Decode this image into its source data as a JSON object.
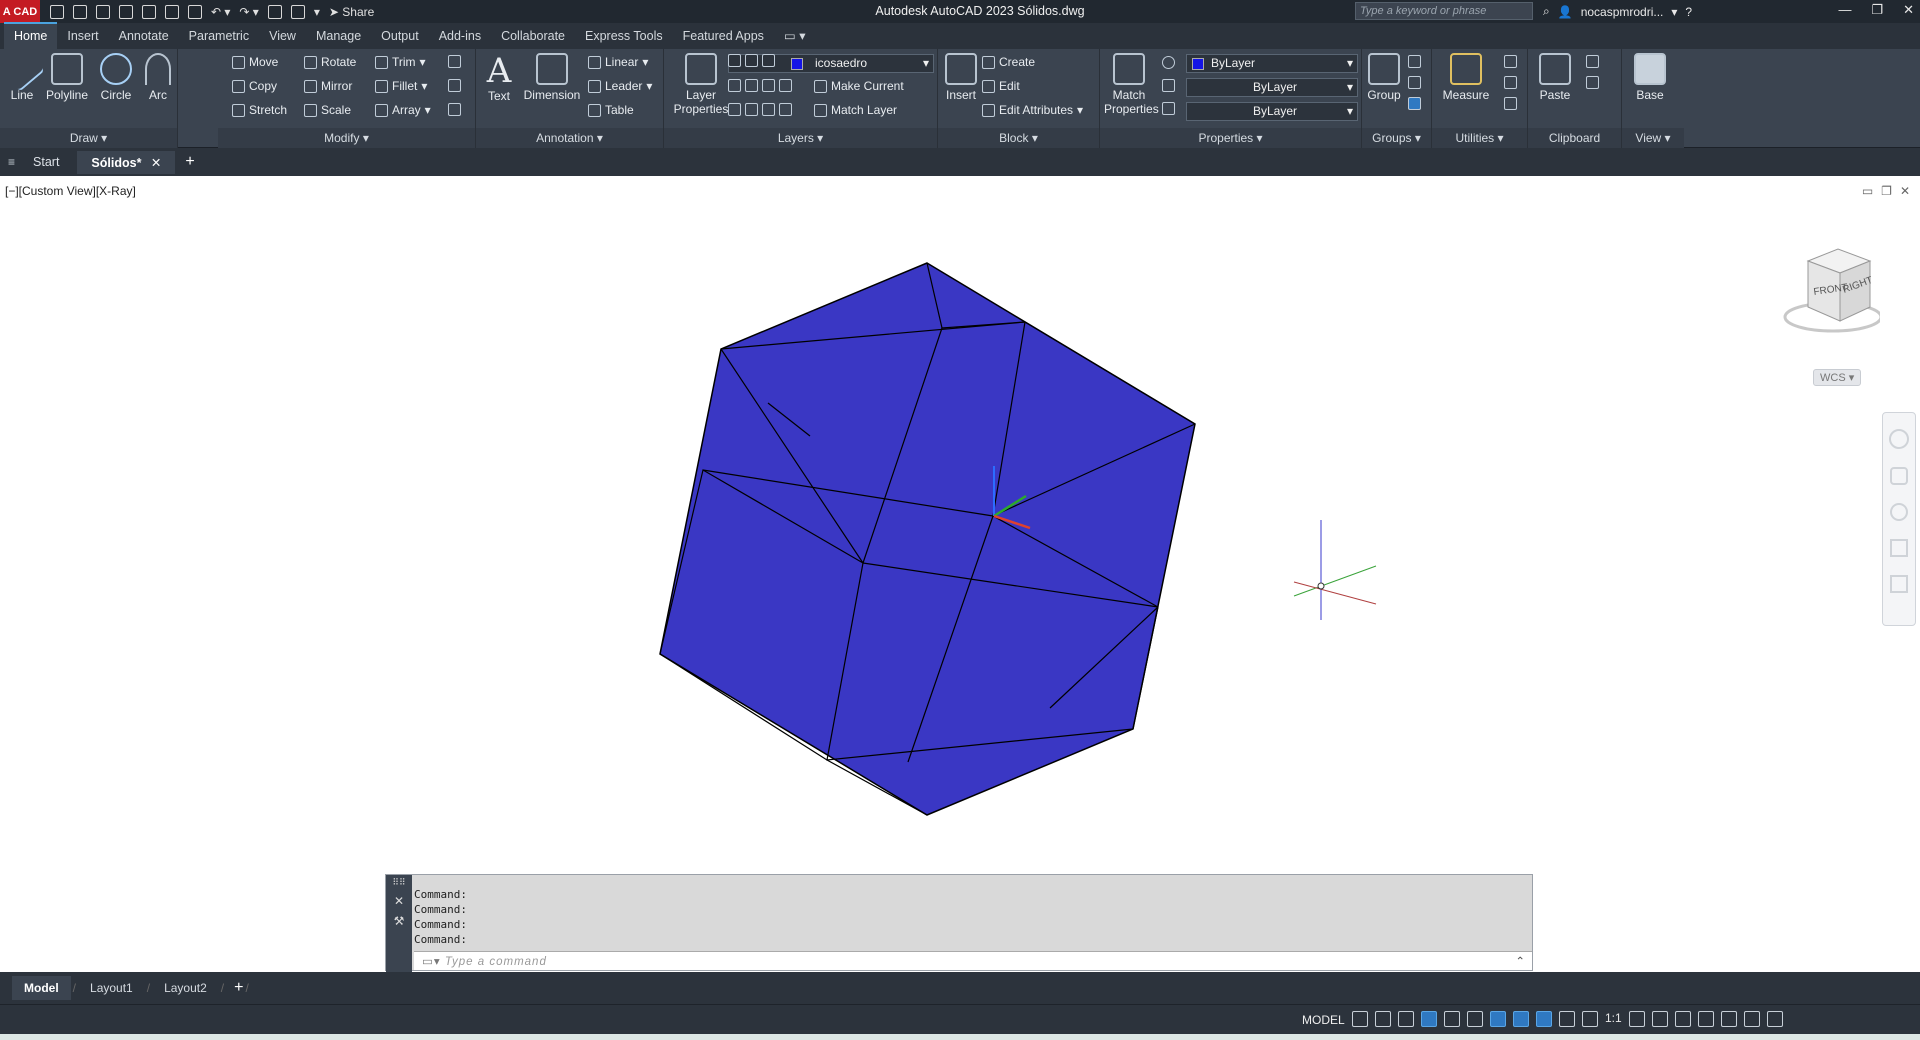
{
  "titlebar": {
    "app_logo": "A CAD",
    "share_label": "Share",
    "title": "Autodesk AutoCAD 2023   Sólidos.dwg",
    "search_placeholder": "Type a keyword or phrase",
    "user": "nocaspmrodri..."
  },
  "ribbon_tabs": [
    "Home",
    "Insert",
    "Annotate",
    "Parametric",
    "View",
    "Manage",
    "Output",
    "Add-ins",
    "Collaborate",
    "Express Tools",
    "Featured Apps"
  ],
  "ribbon": {
    "draw": {
      "line": "Line",
      "polyline": "Polyline",
      "circle": "Circle",
      "arc": "Arc",
      "footer": "Draw ▾"
    },
    "modify": {
      "move": "Move",
      "rotate": "Rotate",
      "trim": "Trim",
      "copy": "Copy",
      "mirror": "Mirror",
      "fillet": "Fillet",
      "stretch": "Stretch",
      "scale": "Scale",
      "array": "Array",
      "footer": "Modify ▾"
    },
    "annotation": {
      "text": "Text",
      "dimension": "Dimension",
      "linear": "Linear",
      "leader": "Leader",
      "table": "Table",
      "footer": "Annotation ▾"
    },
    "layers": {
      "layer_properties_1": "Layer",
      "layer_properties_2": "Properties",
      "current_layer": "icosaedro",
      "make_current": "Make Current",
      "match_layer": "Match Layer",
      "footer": "Layers ▾"
    },
    "block": {
      "insert": "Insert",
      "create": "Create",
      "edit": "Edit",
      "edit_attributes": "Edit Attributes",
      "footer": "Block ▾"
    },
    "properties": {
      "match_1": "Match",
      "match_2": "Properties",
      "color": "ByLayer",
      "linetype": "ByLayer",
      "lineweight": "ByLayer",
      "footer": "Properties ▾"
    },
    "groups": {
      "group": "Group",
      "footer": "Groups ▾"
    },
    "utilities": {
      "measure": "Measure",
      "footer": "Utilities ▾"
    },
    "clipboard": {
      "paste": "Paste",
      "footer": "Clipboard"
    },
    "view": {
      "base": "Base",
      "footer": "View ▾"
    }
  },
  "doc_tabs": {
    "start": "Start",
    "active": "Sólidos*",
    "close": "✕",
    "add": "+"
  },
  "viewport": {
    "label": "[−][Custom View][X-Ray]",
    "cube_front": "FRONT",
    "cube_right": "RIGHT",
    "wcs": "WCS",
    "solid_color": "#3a37c4"
  },
  "command": {
    "history": [
      "Command:",
      "Command:",
      "Command:",
      "Command:"
    ],
    "placeholder": "Type a command"
  },
  "layout_tabs": [
    "Model",
    "Layout1",
    "Layout2"
  ],
  "status": {
    "model": "MODEL",
    "scale": "1:1"
  }
}
